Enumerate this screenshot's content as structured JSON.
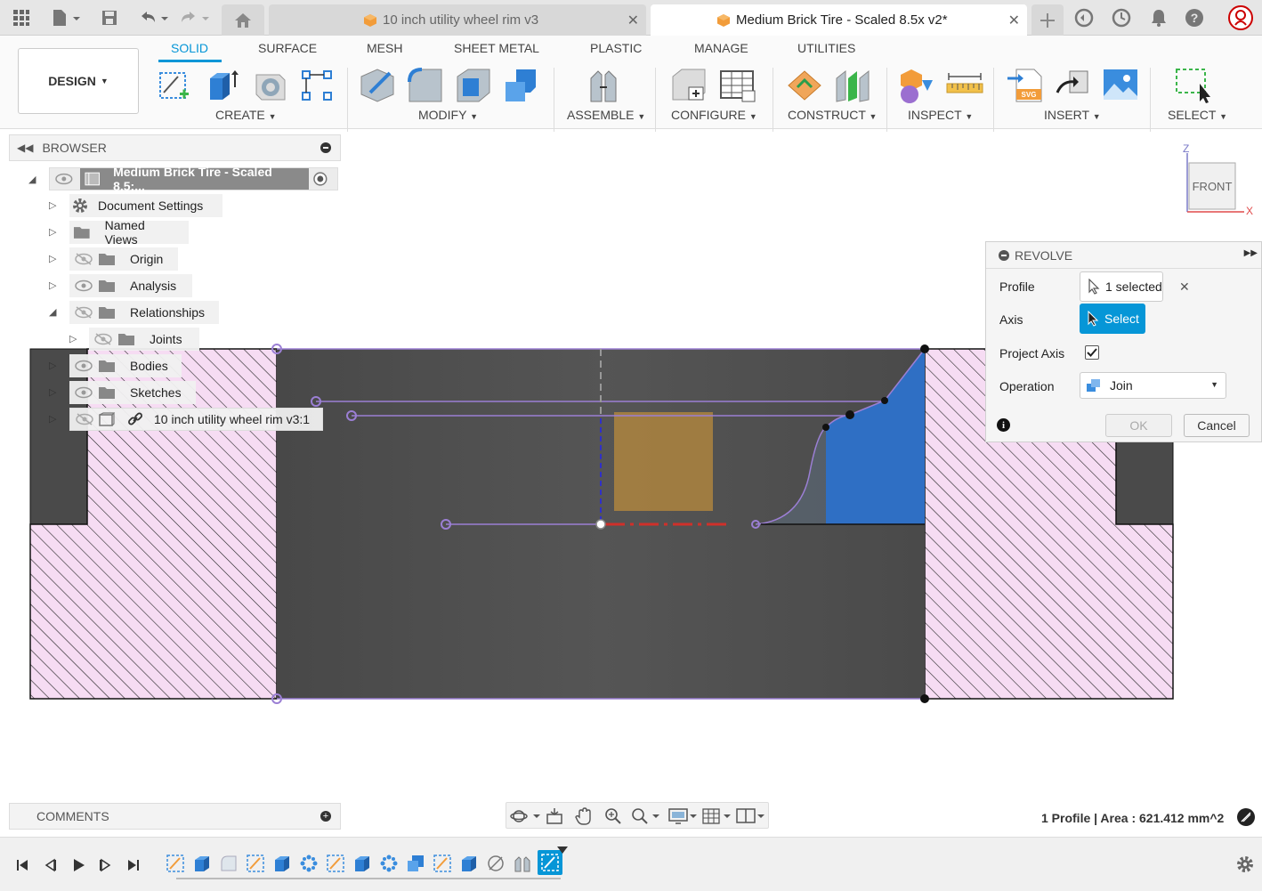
{
  "tabs": [
    {
      "title": "10 inch utility wheel rim v3",
      "active": false
    },
    {
      "title": "Medium Brick Tire - Scaled 8.5x v2*",
      "active": true
    }
  ],
  "workspace": {
    "label": "DESIGN"
  },
  "ribbon_tabs": [
    "SOLID",
    "SURFACE",
    "MESH",
    "SHEET METAL",
    "PLASTIC",
    "MANAGE",
    "UTILITIES"
  ],
  "active_ribbon_tab": "SOLID",
  "tool_groups": {
    "create": "CREATE",
    "modify": "MODIFY",
    "assemble": "ASSEMBLE",
    "configure": "CONFIGURE",
    "construct": "CONSTRUCT",
    "inspect": "INSPECT",
    "insert": "INSERT",
    "select": "SELECT"
  },
  "browser": {
    "title": "BROWSER",
    "root": "Medium Brick Tire - Scaled 8.5:...",
    "items": [
      {
        "label": "Document Settings",
        "icon": "gear-icon"
      },
      {
        "label": "Named Views",
        "icon": "folder-icon"
      },
      {
        "label": "Origin",
        "icon": "folder-icon"
      },
      {
        "label": "Analysis",
        "icon": "folder-icon"
      },
      {
        "label": "Relationships",
        "icon": "folder-icon"
      },
      {
        "label": "Joints",
        "icon": "folder-icon"
      },
      {
        "label": "Bodies",
        "icon": "folder-icon"
      },
      {
        "label": "Sketches",
        "icon": "folder-icon"
      },
      {
        "label": "10 inch utility wheel rim v3:1",
        "icon": "link-icon"
      }
    ]
  },
  "viewcube": {
    "face": "FRONT",
    "axis_z": "Z",
    "axis_x": "X"
  },
  "revolve": {
    "title": "REVOLVE",
    "profile_label": "Profile",
    "profile_value": "1 selected",
    "axis_label": "Axis",
    "axis_value": "Select",
    "project_axis_label": "Project Axis",
    "project_axis_checked": true,
    "operation_label": "Operation",
    "operation_value": "Join",
    "ok_label": "OK",
    "cancel_label": "Cancel"
  },
  "comments": {
    "label": "COMMENTS"
  },
  "status": {
    "text": "1 Profile | Area : 621.412 mm^2"
  },
  "colors": {
    "accent": "#0696d7",
    "sketch_line": "#9b7fd4",
    "profile_fill": "#2f6fc4",
    "hatch": "#f4d7f2"
  }
}
